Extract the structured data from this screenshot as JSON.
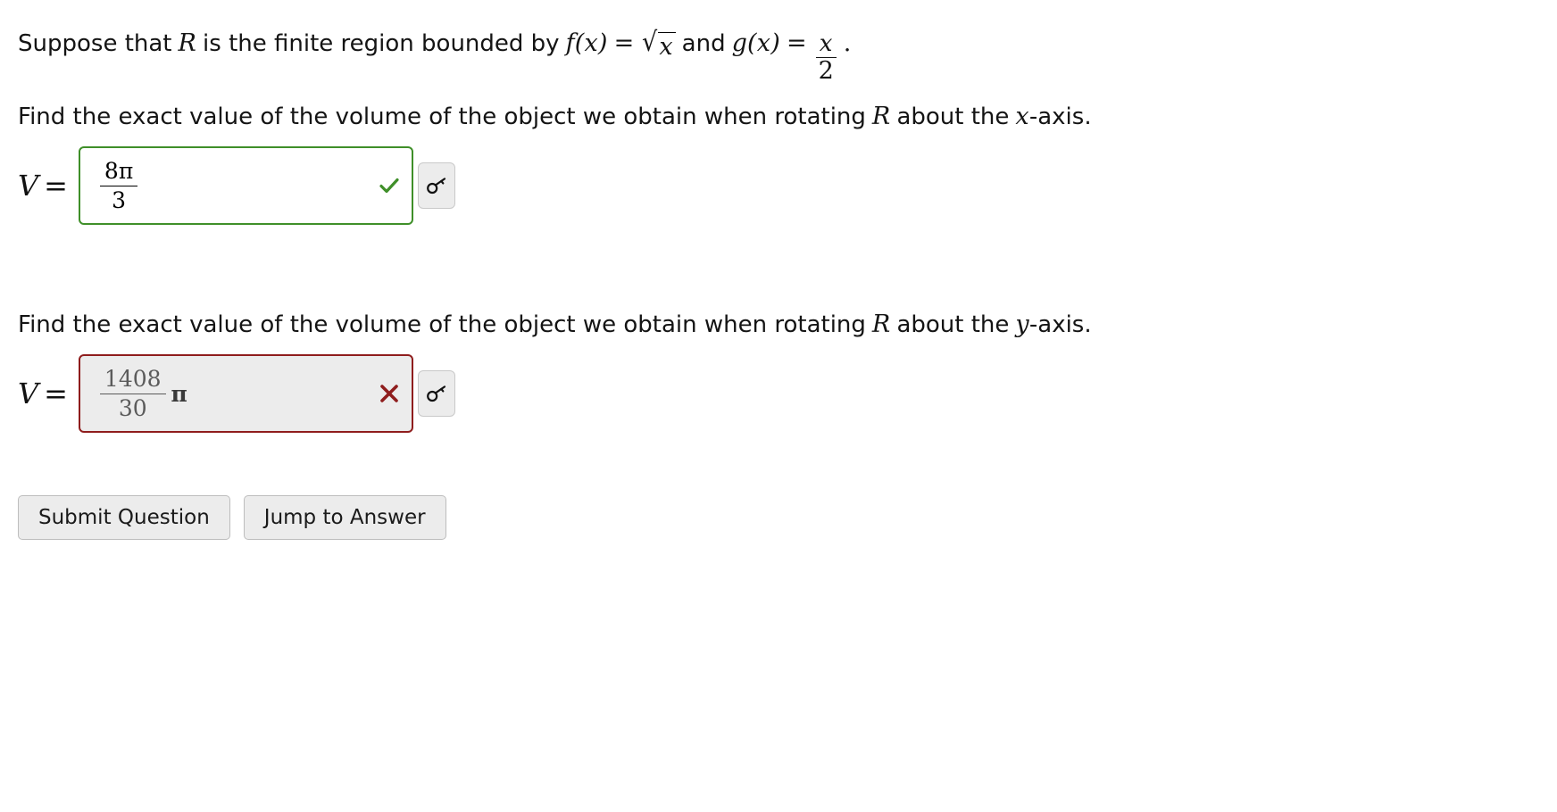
{
  "problem": {
    "intro_prefix": "Suppose that",
    "region_symbol": "R",
    "intro_mid": "is the finite region bounded by",
    "f_name": "f(x)",
    "equals": "=",
    "f_body_radicand": "x",
    "conjunction": "and",
    "g_name": "g(x)",
    "g_num": "x",
    "g_den": "2",
    "period": "."
  },
  "parts": [
    {
      "prompt_prefix": "Find the exact value of the volume of the object we obtain when rotating",
      "prompt_symbol": "R",
      "prompt_mid": "about the",
      "axis": "x",
      "prompt_suffix": "-axis.",
      "answer_label": "V",
      "answer_equals": "=",
      "answer": {
        "numerator": "8π",
        "denominator": "3",
        "trailing": "",
        "status": "correct",
        "status_icon": "check-icon",
        "status_color": "#3f8f29"
      },
      "key_button_icon": "key-icon"
    },
    {
      "prompt_prefix": "Find the exact value of the volume of the object we obtain when rotating",
      "prompt_symbol": "R",
      "prompt_mid": "about the",
      "axis": "y",
      "prompt_suffix": "-axis.",
      "answer_label": "V",
      "answer_equals": "=",
      "answer": {
        "numerator": "1408",
        "denominator": "30",
        "trailing": "π",
        "status": "incorrect",
        "status_icon": "cross-icon",
        "status_color": "#8f1d1d"
      },
      "key_button_icon": "key-icon"
    }
  ],
  "footer": {
    "submit_label": "Submit Question",
    "jump_label": "Jump to Answer"
  },
  "colors": {
    "correct_border": "#3f8f29",
    "incorrect_border": "#8f1d1d",
    "incorrect_fill": "#ececec",
    "button_fill": "#ececec",
    "text": "#141414"
  }
}
